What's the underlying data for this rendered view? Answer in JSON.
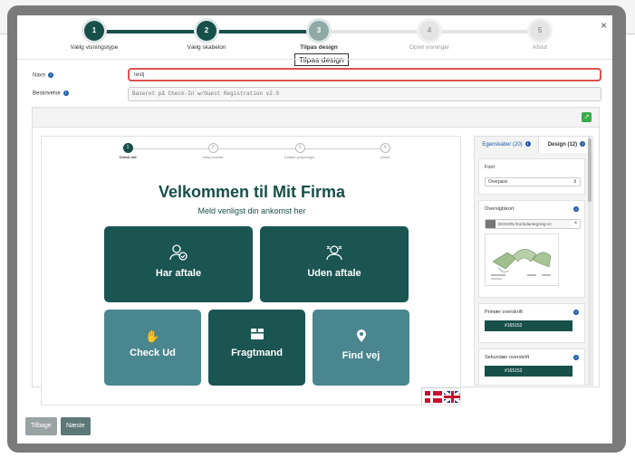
{
  "wizard": {
    "steps": [
      {
        "num": "1",
        "label": "Vælg visningstype",
        "state": "done"
      },
      {
        "num": "2",
        "label": "Vælg skabelon",
        "state": "done"
      },
      {
        "num": "3",
        "label": "Tilpas design",
        "state": "active"
      },
      {
        "num": "4",
        "label": "Opret visninger",
        "state": "todo"
      },
      {
        "num": "5",
        "label": "Afslut",
        "state": "todo"
      }
    ],
    "tooltip": "Tilpas design",
    "close": "×"
  },
  "form": {
    "name_label": "Navn",
    "name_value": "Test|",
    "desc_label": "Beskrivelse",
    "desc_value": "Baseret på Check-In w/Guest Registration v2.0"
  },
  "preview": {
    "steps": [
      {
        "num": "1",
        "label": "Check ind"
      },
      {
        "num": "2",
        "label": "Vælg kontakt"
      },
      {
        "num": "3",
        "label": "Indtast oplysninger"
      },
      {
        "num": "4",
        "label": "Afslut"
      }
    ],
    "title": "Velkommen til Mit Firma",
    "subtitle": "Meld venligst din ankomst her",
    "tiles": [
      {
        "label": "Har aftale",
        "icon": "person-check-icon"
      },
      {
        "label": "Uden aftale",
        "icon": "person-x-icon"
      },
      {
        "label": "Check Ud",
        "icon": "waving-hand-icon"
      },
      {
        "label": "Fragtmand",
        "icon": "package-icon"
      },
      {
        "label": "Find vej",
        "icon": "map-pin-icon"
      }
    ]
  },
  "side_panel": {
    "tab_properties": "Egenskaber (20)",
    "tab_design": "Design (12)",
    "font_label": "Font",
    "font_value": "Overpass",
    "overview_label": "Oversigtskort",
    "overview_file": "DESIGN:/Kort/plantegning-v2",
    "primary_label": "Primær overskrift",
    "primary_color": "#165152",
    "secondary_label": "Sekundær overskrift",
    "secondary_color": "#165152"
  },
  "footer": {
    "back": "Tilbage",
    "next": "Næste"
  },
  "colors": {
    "brand": "#174f49",
    "tile_dark": "#1a5552",
    "tile_light": "#4a8690",
    "error_border": "#d9534f",
    "add_button": "#3aa94a"
  }
}
